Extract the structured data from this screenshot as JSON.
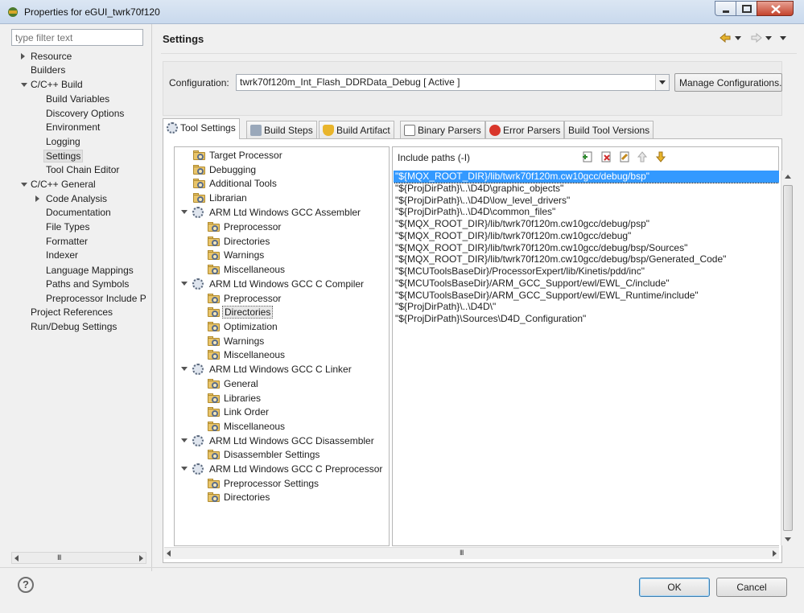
{
  "window": {
    "title": "Properties for eGUI_twrk70f120"
  },
  "filter": {
    "placeholder": "type filter text"
  },
  "nav": {
    "items": [
      {
        "label": "Resource"
      },
      {
        "label": "Builders"
      },
      {
        "label": "C/C++ Build"
      },
      {
        "label": "Build Variables"
      },
      {
        "label": "Discovery Options"
      },
      {
        "label": "Environment"
      },
      {
        "label": "Logging"
      },
      {
        "label": "Settings"
      },
      {
        "label": "Tool Chain Editor"
      },
      {
        "label": "C/C++ General"
      },
      {
        "label": "Code Analysis"
      },
      {
        "label": "Documentation"
      },
      {
        "label": "File Types"
      },
      {
        "label": "Formatter"
      },
      {
        "label": "Indexer"
      },
      {
        "label": "Language Mappings"
      },
      {
        "label": "Paths and Symbols"
      },
      {
        "label": "Preprocessor Include Pa"
      },
      {
        "label": "Project References"
      },
      {
        "label": "Run/Debug Settings"
      }
    ]
  },
  "page": {
    "title": "Settings"
  },
  "config": {
    "label": "Configuration:",
    "value": "twrk70f120m_Int_Flash_DDRData_Debug  [ Active ]",
    "manage_label": "Manage Configurations..."
  },
  "tabs": [
    {
      "label": "Tool Settings"
    },
    {
      "label": "Build Steps"
    },
    {
      "label": "Build Artifact"
    },
    {
      "label": "Binary Parsers"
    },
    {
      "label": "Error Parsers"
    },
    {
      "label": "Build Tool Versions"
    }
  ],
  "tool_tree": [
    {
      "label": "Target Processor"
    },
    {
      "label": "Debugging"
    },
    {
      "label": "Additional Tools"
    },
    {
      "label": "Librarian"
    },
    {
      "label": "ARM Ltd Windows GCC Assembler"
    },
    {
      "label": "Preprocessor"
    },
    {
      "label": "Directories"
    },
    {
      "label": "Warnings"
    },
    {
      "label": "Miscellaneous"
    },
    {
      "label": "ARM Ltd Windows GCC C Compiler"
    },
    {
      "label": "Preprocessor"
    },
    {
      "label": "Directories"
    },
    {
      "label": "Optimization"
    },
    {
      "label": "Warnings"
    },
    {
      "label": "Miscellaneous"
    },
    {
      "label": "ARM Ltd Windows GCC C Linker"
    },
    {
      "label": "General"
    },
    {
      "label": "Libraries"
    },
    {
      "label": "Link Order"
    },
    {
      "label": "Miscellaneous"
    },
    {
      "label": "ARM Ltd Windows GCC Disassembler"
    },
    {
      "label": "Disassembler Settings"
    },
    {
      "label": "ARM Ltd Windows GCC C Preprocessor"
    },
    {
      "label": "Preprocessor Settings"
    },
    {
      "label": "Directories"
    }
  ],
  "include": {
    "label": "Include paths (-I)",
    "paths": [
      "\"${MQX_ROOT_DIR}/lib/twrk70f120m.cw10gcc/debug/bsp\"",
      "\"${ProjDirPath}\\..\\D4D\\graphic_objects\"",
      "\"${ProjDirPath}\\..\\D4D\\low_level_drivers\"",
      "\"${ProjDirPath}\\..\\D4D\\common_files\"",
      "\"${MQX_ROOT_DIR}/lib/twrk70f120m.cw10gcc/debug/psp\"",
      "\"${MQX_ROOT_DIR}/lib/twrk70f120m.cw10gcc/debug\"",
      "\"${MQX_ROOT_DIR}/lib/twrk70f120m.cw10gcc/debug/bsp/Sources\"",
      "\"${MQX_ROOT_DIR}/lib/twrk70f120m.cw10gcc/debug/bsp/Generated_Code\"",
      "\"${MCUToolsBaseDir}/ProcessorExpert/lib/Kinetis/pdd/inc\"",
      "\"${MCUToolsBaseDir}/ARM_GCC_Support/ewl/EWL_C/include\"",
      "\"${MCUToolsBaseDir}/ARM_GCC_Support/ewl/EWL_Runtime/include\"",
      "\"${ProjDirPath}\\..\\D4D\\\"",
      "\"${ProjDirPath}\\Sources\\D4D_Configuration\""
    ]
  },
  "buttons": {
    "ok": "OK",
    "cancel": "Cancel",
    "help": "?"
  },
  "colors": {
    "selection": "#3399ff",
    "title_bar": "#c9d9ed"
  }
}
